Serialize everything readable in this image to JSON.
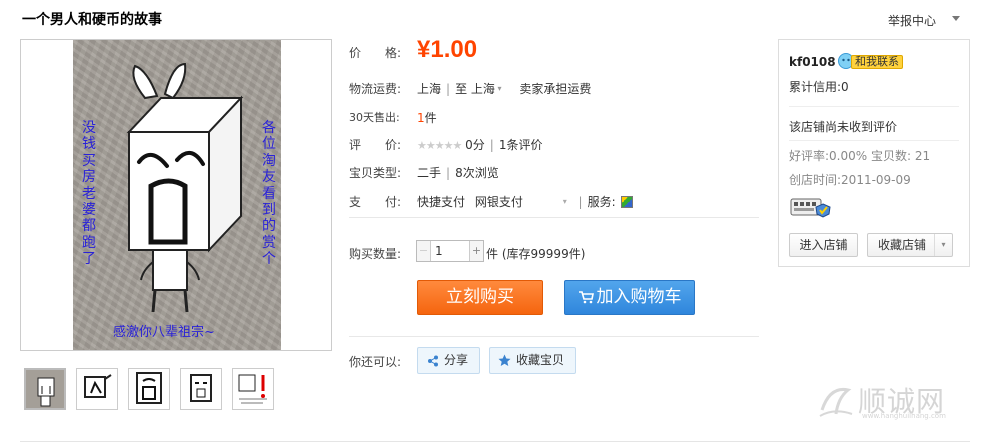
{
  "product": {
    "title": "一个男人和硬币的故事",
    "report_label": "举报中心"
  },
  "image": {
    "left_text": "没钱买房老婆都跑了",
    "right_text": "各位淘友看到的赏个",
    "bottom_text": "感激你八辈祖宗~",
    "thumbnails": [
      {
        "name": "thumb-1",
        "active": true
      },
      {
        "name": "thumb-2",
        "active": false
      },
      {
        "name": "thumb-3",
        "active": false
      },
      {
        "name": "thumb-4",
        "active": false
      },
      {
        "name": "thumb-5",
        "active": false
      }
    ]
  },
  "details": {
    "price_label": "价　　格:",
    "price": "¥1.00",
    "shipping_label": "物流运费:",
    "shipping_from": "上海",
    "shipping_to_sep": "至",
    "shipping_to": "上海",
    "shipping_fee": "卖家承担运费",
    "sold_label": "30天售出:",
    "sold_count": "1",
    "sold_unit": "件",
    "rating_label": "评　　价:",
    "rating_score": "0分",
    "rating_count": "1条评价",
    "type_label": "宝贝类型:",
    "type_value": "二手",
    "views": "8次浏览",
    "pay_label": "支　　付:",
    "pay_methods": [
      "快捷支付",
      "网银支付"
    ],
    "service_label": "服务:",
    "qty_label": "购买数量:",
    "qty_value": "1",
    "qty_unit": "件",
    "stock": "(库存99999件)",
    "buy_now": "立刻购买",
    "add_cart": "加入购物车",
    "also_label": "你还可以:",
    "share": "分享",
    "favorite": "收藏宝贝"
  },
  "seller": {
    "name": "kf0108",
    "contact": "和我联系",
    "credit": "累计信用:0",
    "no_review": "该店铺尚未收到评价",
    "good_rate": "好评率:0.00%",
    "item_count": "宝贝数: 21",
    "created": "创店时间:2011-09-09",
    "enter_store": "进入店铺",
    "fav_store": "收藏店铺"
  },
  "watermark": {
    "text": "顺诚网",
    "url": "www.hanghuilhang.com"
  },
  "colors": {
    "price": "#ff4400",
    "buy": "#f5650f",
    "cart": "#2f86dc",
    "link": "#3366cc"
  }
}
